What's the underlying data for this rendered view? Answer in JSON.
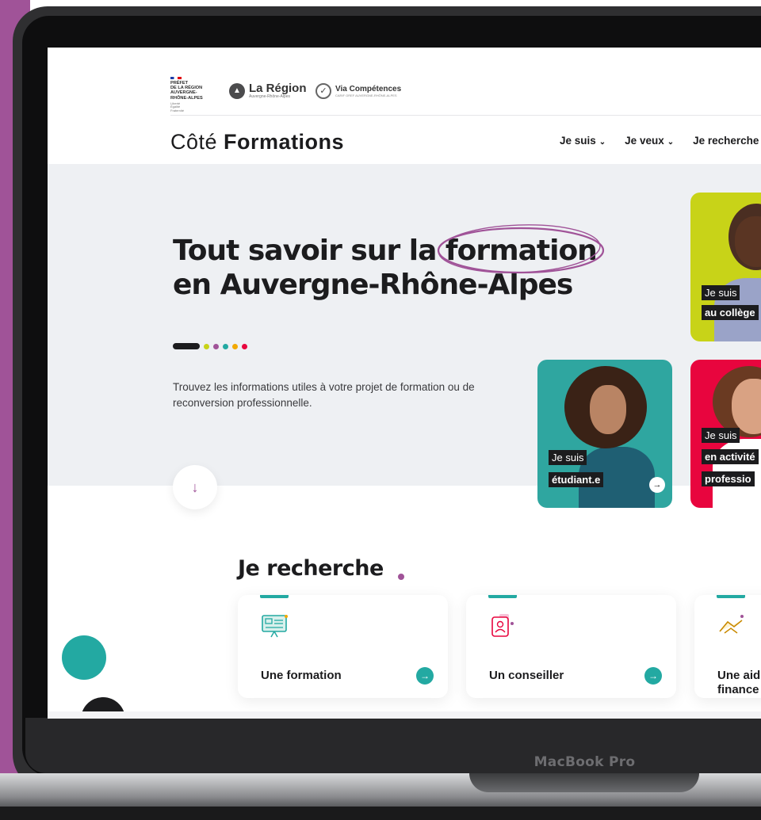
{
  "device": {
    "label": "MacBook Pro"
  },
  "logos": {
    "prefet": [
      "PRÉFET",
      "DE LA RÉGION",
      "AUVERGNE-",
      "RHÔNE-ALPES"
    ],
    "prefet_motto": [
      "Liberté",
      "Égalité",
      "Fraternité"
    ],
    "region": {
      "name": "La Région",
      "sub": "Auvergne-Rhône-Alpes"
    },
    "via": {
      "name": "Via Compétences",
      "sub": "CARIF OREF AUVERGNE-RHÔNE-ALPES"
    }
  },
  "brand": {
    "part1": "Côté ",
    "part2": "Formations"
  },
  "nav": [
    {
      "label": "Je suis"
    },
    {
      "label": "Je veux"
    },
    {
      "label": "Je recherche"
    }
  ],
  "hero": {
    "title_line1": "Tout savoir sur la formation",
    "title_line2": "en Auvergne-Rhône-Alpes",
    "subtitle": "Trouvez les informations utiles à votre projet de formation ou de reconversion professionnelle.",
    "scroll_icon": "arrow-down-icon"
  },
  "profiles": [
    {
      "prefix": "Je suis",
      "label": "au collège"
    },
    {
      "prefix": "Je suis",
      "label": "étudiant.e"
    },
    {
      "prefix": "Je suis",
      "label": "en activité",
      "label2": "professio"
    }
  ],
  "search": {
    "title": "Je recherche",
    "cards": [
      {
        "label": "Une formation",
        "icon": "training-icon"
      },
      {
        "label": "Un conseiller",
        "icon": "advisor-icon"
      },
      {
        "label_line1": "Une aid",
        "label_line2": "finance",
        "icon": "handshake-icon"
      }
    ]
  },
  "colors": {
    "accent_purple": "#a05398",
    "teal": "#23a9a2",
    "lime": "#c8d318",
    "red": "#e8053e",
    "dots": [
      "#c8d318",
      "#a05398",
      "#23a9a2",
      "#f2a900",
      "#e8053e"
    ]
  }
}
